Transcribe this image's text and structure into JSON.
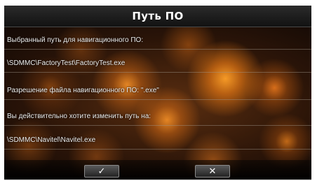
{
  "dialog": {
    "title": "Путь ПО",
    "selected_path_label": "Выбранный путь для навигационного ПО:",
    "selected_path_value": "\\SDMMC\\FactoryTest\\FactoryTest.exe",
    "file_extension_label": "Разрешение файла навигационного ПО: \".exe\"",
    "confirm_question": "Вы действительно хотите изменить путь на:",
    "new_path_value": "\\SDMMC\\Navitel\\Navitel.exe"
  },
  "buttons": {
    "confirm_icon": "checkmark-icon",
    "confirm_glyph": "✓",
    "cancel_icon": "close-icon",
    "cancel_glyph": "✕"
  },
  "colors": {
    "background_accent": "#e0801c",
    "text": "#ececec",
    "title_bar": "#1c1c1c"
  }
}
